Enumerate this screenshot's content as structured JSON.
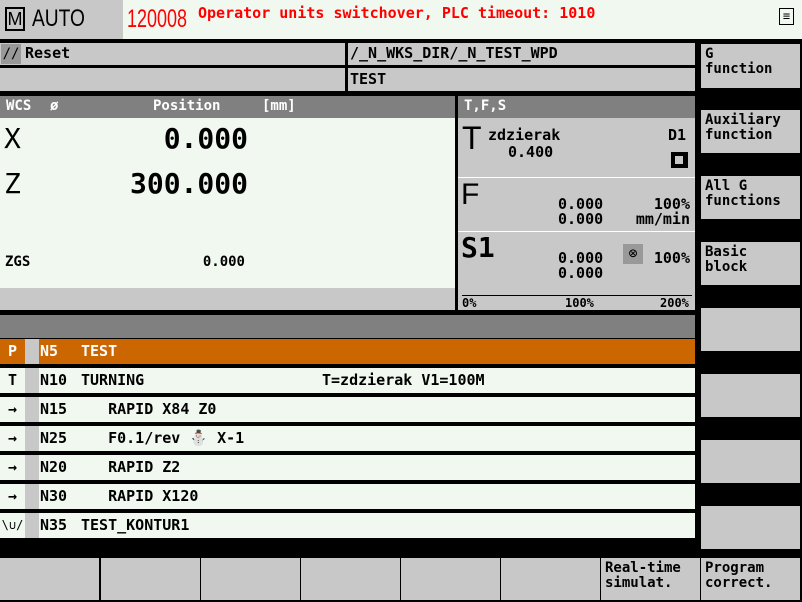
{
  "header": {
    "mode_icon": "M",
    "mode": "AUTO",
    "alarm_number": "120008",
    "alarm_text": "Operator units switchover, PLC timeout: 1010",
    "alarm_color": "#ff0000",
    "menu_icon": "menu-icon"
  },
  "status": {
    "reset_icon": "reset-slash-icon",
    "reset": "Reset",
    "path": "/_N_WKS_DIR/_N_TEST_WPD",
    "program": "TEST"
  },
  "wcs": {
    "title": "WCS",
    "diameter": "ø",
    "position_label": "Position",
    "unit": "[mm]",
    "axes": [
      {
        "name": "X",
        "value": "0.000"
      },
      {
        "name": "Z",
        "value": "300.000"
      }
    ],
    "zgs_label": "ZGS",
    "zgs_value": "0.000"
  },
  "tfs": {
    "title": "T,F,S",
    "t_label": "T",
    "tool": "zdzierak",
    "tool_value": "0.400",
    "d": "D1",
    "f_label": "F",
    "f_value1": "0.000",
    "f_value2": "0.000",
    "f_override": "100%",
    "f_unit": "mm/min",
    "s_label": "S1",
    "s_value1": "0.000",
    "s_value2": "0.000",
    "s_override": "100%",
    "scale": [
      "0%",
      "100%",
      "200%"
    ]
  },
  "program": {
    "rows": [
      {
        "prefix": "P",
        "n": "N5",
        "text": "TEST",
        "comment": "",
        "active": true
      },
      {
        "prefix": "T",
        "n": "N10",
        "text": "TURNING",
        "comment": "T=zdzierak V1=100M"
      },
      {
        "prefix": "→",
        "n": "N15",
        "text": "   RAPID X84 Z0",
        "comment": ""
      },
      {
        "prefix": "→",
        "n": "N25",
        "text": "   F0.1/rev ⛄ X-1",
        "comment": ""
      },
      {
        "prefix": "→",
        "n": "N20",
        "text": "   RAPID Z2",
        "comment": ""
      },
      {
        "prefix": "→",
        "n": "N30",
        "text": "   RAPID X120",
        "comment": ""
      },
      {
        "prefix": "\\∪/",
        "n": "N35",
        "text": "TEST_KONTUR1",
        "comment": ""
      }
    ]
  },
  "right_softkeys": [
    "G\nfunction",
    "Auxiliary\nfunction",
    "All G\nfunctions",
    "Basic\nblock",
    "",
    "",
    "",
    ""
  ],
  "bottom_softkeys": [
    "",
    "",
    "",
    "",
    "",
    "",
    "Real-time\nsimulat.",
    "Program\ncorrect."
  ],
  "colors": {
    "active_row": "#cc6600",
    "panel": "#c8c8c8",
    "header": "#808080"
  }
}
